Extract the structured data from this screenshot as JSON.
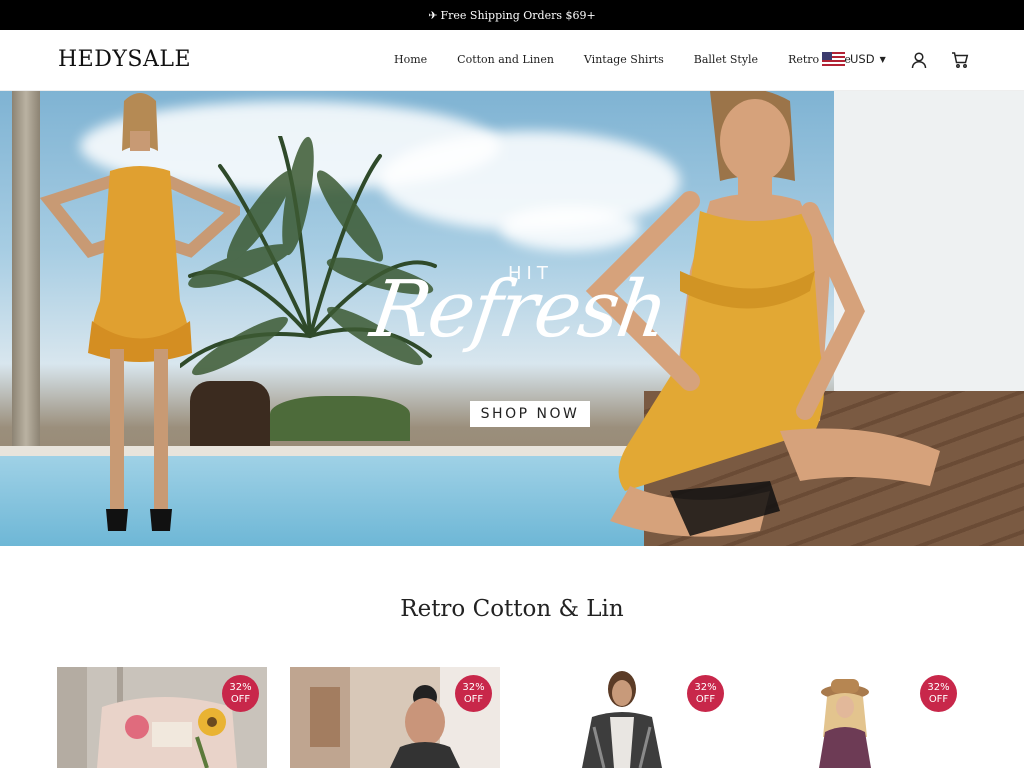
{
  "announcement": {
    "icon": "airplane-icon",
    "text": "Free Shipping Orders $69+"
  },
  "header": {
    "logo": "HEDYSALE",
    "nav": [
      {
        "label": "Home"
      },
      {
        "label": "Cotton and Linen"
      },
      {
        "label": "Vintage Shirts"
      },
      {
        "label": "Ballet Style"
      },
      {
        "label": "Retro Style"
      }
    ],
    "currency": "USD",
    "account_icon": "user-icon",
    "cart_icon": "cart-icon"
  },
  "hero": {
    "line1": "HIT",
    "line2": "Refresh",
    "cta": "SHOP NOW"
  },
  "section": {
    "title": "Retro Cotton & Lin"
  },
  "products": [
    {
      "badge_pct": "32%",
      "badge_off": "OFF"
    },
    {
      "badge_pct": "32%",
      "badge_off": "OFF"
    },
    {
      "badge_pct": "32%",
      "badge_off": "OFF"
    },
    {
      "badge_pct": "32%",
      "badge_off": "OFF"
    }
  ],
  "colors": {
    "badge": "#c8274a",
    "announcement_bg": "#000000"
  }
}
